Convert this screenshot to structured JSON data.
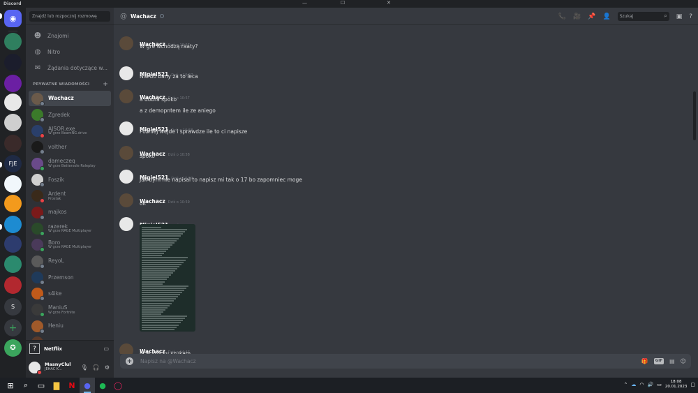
{
  "app": {
    "title": "Discord"
  },
  "servers": [
    {
      "name": "Direct Messages",
      "label": "",
      "color": "#5865f2"
    },
    {
      "name": "server-1",
      "label": "",
      "color": "#2f7f5f"
    },
    {
      "name": "server-2",
      "label": "",
      "color": "#1b1d2c"
    },
    {
      "name": "server-3",
      "label": "",
      "color": "#6b1fa3"
    },
    {
      "name": "server-4",
      "label": "",
      "color": "#e8e8e8"
    },
    {
      "name": "server-5",
      "label": "",
      "color": "#cfcfcf"
    },
    {
      "name": "server-6",
      "label": "",
      "color": "#3a2a2a"
    },
    {
      "name": "server-7",
      "label": "FJE",
      "color": "#1f2a44"
    },
    {
      "name": "server-8",
      "label": "",
      "color": "#f1f7fb"
    },
    {
      "name": "server-9",
      "label": "",
      "color": "#f39a1c"
    },
    {
      "name": "server-10",
      "label": "",
      "color": "#1d8bd1"
    },
    {
      "name": "server-11",
      "label": "",
      "color": "#2d3c6e"
    },
    {
      "name": "server-12",
      "label": "",
      "color": "#2b8a6e"
    },
    {
      "name": "server-13",
      "label": "",
      "color": "#b2282f"
    },
    {
      "name": "server-14",
      "label": "S",
      "color": "#36393f"
    },
    {
      "name": "add-server",
      "label": "+",
      "color": "#36393f"
    },
    {
      "name": "explore",
      "label": "",
      "color": "#3ba55d"
    }
  ],
  "sidebar": {
    "search_placeholder": "Znajdź lub rozpocznij rozmowę",
    "nav": [
      {
        "label": "Znajomi",
        "icon": "friends-icon"
      },
      {
        "label": "Nitro",
        "icon": "nitro-icon"
      },
      {
        "label": "Żądania dotyczące w...",
        "icon": "message-requests-icon"
      }
    ],
    "dm_header": "PRYWATNE WIADOMOŚCI",
    "dms": [
      {
        "name": "Wachacz",
        "sub": "",
        "status": "offline",
        "color": "#6b5a4a",
        "active": true
      },
      {
        "name": "Zgredek",
        "sub": "",
        "status": "offline",
        "color": "#3b7a2a"
      },
      {
        "name": "AJSOR.exe",
        "sub": "W grze BeamNG.drive",
        "status": "dnd",
        "color": "#2a3f6a"
      },
      {
        "name": "volther",
        "sub": "",
        "status": "offline",
        "color": "#1a1a1a"
      },
      {
        "name": "dameczeq",
        "sub": "W grze Bettersole Roleplay",
        "status": "online",
        "color": "#6a4a8a"
      },
      {
        "name": "Foszik",
        "sub": "",
        "status": "offline",
        "color": "#d0d0d0"
      },
      {
        "name": "Ardent",
        "sub": "Prostak",
        "status": "dnd",
        "color": "#3a2a1a"
      },
      {
        "name": "majkos",
        "sub": "",
        "status": "offline",
        "color": "#7a1a1a"
      },
      {
        "name": "razerek",
        "sub": "W grze RAGE Multiplayer",
        "status": "online",
        "color": "#2a4a2a"
      },
      {
        "name": "Boro",
        "sub": "W grze RAGE Multiplayer",
        "status": "online",
        "color": "#4a3a5a"
      },
      {
        "name": "ReyoL",
        "sub": "",
        "status": "offline",
        "color": "#5a5a5a"
      },
      {
        "name": "Przemson",
        "sub": "",
        "status": "offline",
        "color": "#1f3a5a"
      },
      {
        "name": "s4ike",
        "sub": "",
        "status": "offline",
        "color": "#c05a1a"
      },
      {
        "name": "ManiuS",
        "sub": "W grze Fortnite",
        "status": "online",
        "color": "#3a3a3a"
      },
      {
        "name": "Heniu",
        "sub": "",
        "status": "offline",
        "color": "#a05a2a"
      },
      {
        "name": "Fisek",
        "sub": "",
        "status": "offline",
        "color": "#5a3a2a"
      }
    ],
    "activity": {
      "title": "Netflix"
    },
    "user": {
      "name": "MasnyClul",
      "sub": "JEHAC K...",
      "status": "dnd"
    }
  },
  "channel": {
    "name": "Wachacz",
    "search_placeholder": "Szukaj",
    "composer_placeholder": "Napisz na @Wachacz"
  },
  "messages": [
    {
      "author": "Wachacz",
      "time": "Dziś o 10:57",
      "lines": [
        "W gre wchodzą raaty?"
      ],
      "avatar": "#5a4a3a"
    },
    {
      "author": "Migiel521",
      "time": "Dziś o 10:57",
      "lines": [
        "Nie bo bany za to leca"
      ],
      "avatar": "#e8e8e8"
    },
    {
      "author": "Wachacz",
      "time": "Dziś o 10:57",
      "lines": [
        "a dobra spoko",
        "a z demopntem ile ze aniego"
      ],
      "avatar": "#5a4a3a"
    },
    {
      "author": "Migiel521",
      "time": "Dziś o 10:58",
      "lines": [
        "Pozniej wejde i sprawdze ile to ci napisze"
      ],
      "avatar": "#e8e8e8"
    },
    {
      "author": "Wachacz",
      "time": "Dziś o 10:58",
      "lines": [
        "spoko"
      ],
      "avatar": "#5a4a3a"
    },
    {
      "author": "Migiel521",
      "time": "Dziś o 10:59",
      "lines": [
        "Jak bym nie napisal to napisz mi tak o 17 bo zapomniec moge"
      ],
      "avatar": "#e8e8e8"
    },
    {
      "author": "Wachacz",
      "time": "Dziś o 10:59",
      "lines": [
        "ok"
      ],
      "avatar": "#5a4a3a"
    },
    {
      "author": "Migiel521",
      "time": "Dziś o 14:42",
      "lines": [],
      "attachment": true,
      "avatar": "#e8e8e8"
    },
    {
      "author": "Wachacz",
      "time": "Dziś o 14:47",
      "lines": [
        "ja w stocku szukam"
      ],
      "avatar": "#5a4a3a"
    }
  ],
  "taskbar": {
    "clock_time": "18:08",
    "clock_date": "20.01.2023"
  },
  "colors": {
    "online": "#3ba55d",
    "dnd": "#ed4245",
    "offline": "#747f8d",
    "idle": "#faa81a"
  }
}
